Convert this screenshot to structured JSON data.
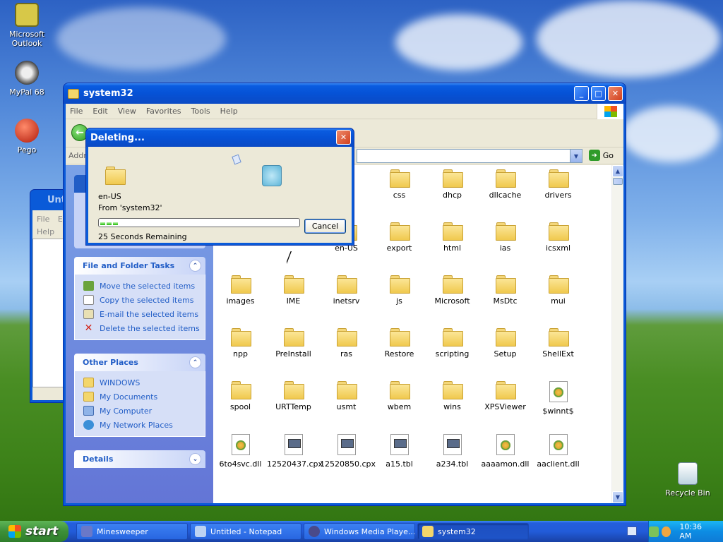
{
  "desktop": {
    "icons": [
      {
        "label": "Microsoft Outlook"
      },
      {
        "label": "MyPal 68"
      },
      {
        "label": "Pego"
      },
      {
        "label": "Recycle Bin"
      }
    ]
  },
  "explorer": {
    "title": "system32",
    "menu": [
      "File",
      "Edit",
      "View",
      "Favorites",
      "Tools",
      "Help"
    ],
    "address_label": "Address",
    "go_label": "Go",
    "file_tasks": {
      "title": "File and Folder Tasks",
      "items": [
        "Move the selected items",
        "Copy the selected items",
        "E-mail the selected items",
        "Delete the selected items"
      ]
    },
    "other_places": {
      "title": "Other Places",
      "items": [
        "WINDOWS",
        "My Documents",
        "My Computer",
        "My Network Places"
      ]
    },
    "details": {
      "title": "Details"
    },
    "files": [
      {
        "name": "css",
        "type": "folder"
      },
      {
        "name": "dhcp",
        "type": "folder"
      },
      {
        "name": "dllcache",
        "type": "folder"
      },
      {
        "name": "drivers",
        "type": "folder"
      },
      {
        "name": "en-US",
        "type": "folder"
      },
      {
        "name": "export",
        "type": "folder"
      },
      {
        "name": "html",
        "type": "folder"
      },
      {
        "name": "ias",
        "type": "folder"
      },
      {
        "name": "icsxml",
        "type": "folder"
      },
      {
        "name": "images",
        "type": "folder"
      },
      {
        "name": "IME",
        "type": "folder"
      },
      {
        "name": "inetsrv",
        "type": "folder"
      },
      {
        "name": "js",
        "type": "folder"
      },
      {
        "name": "Microsoft",
        "type": "folder"
      },
      {
        "name": "MsDtc",
        "type": "folder"
      },
      {
        "name": "mui",
        "type": "folder"
      },
      {
        "name": "npp",
        "type": "folder"
      },
      {
        "name": "PreInstall",
        "type": "folder"
      },
      {
        "name": "ras",
        "type": "folder"
      },
      {
        "name": "Restore",
        "type": "folder"
      },
      {
        "name": "scripting",
        "type": "folder"
      },
      {
        "name": "Setup",
        "type": "folder"
      },
      {
        "name": "ShellExt",
        "type": "folder"
      },
      {
        "name": "spool",
        "type": "folder"
      },
      {
        "name": "URTTemp",
        "type": "folder"
      },
      {
        "name": "usmt",
        "type": "folder"
      },
      {
        "name": "wbem",
        "type": "folder"
      },
      {
        "name": "wins",
        "type": "folder"
      },
      {
        "name": "XPSViewer",
        "type": "folder"
      },
      {
        "name": "$winnt$",
        "type": "dll"
      },
      {
        "name": "6to4svc.dll",
        "type": "dll"
      },
      {
        "name": "12520437.cpx",
        "type": "tbl"
      },
      {
        "name": "12520850.cpx",
        "type": "tbl"
      },
      {
        "name": "a15.tbl",
        "type": "tbl"
      },
      {
        "name": "a234.tbl",
        "type": "tbl"
      },
      {
        "name": "aaaamon.dll",
        "type": "dll"
      },
      {
        "name": "aaclient.dll",
        "type": "dll"
      }
    ]
  },
  "notepad_behind": {
    "title": "Unt",
    "menu": [
      "File",
      "E",
      "Help"
    ]
  },
  "dialog": {
    "title": "Deleting...",
    "item_name": "en-US",
    "from_text": "From 'system32'",
    "progress_fraction": 0.09,
    "remaining": "25 Seconds Remaining",
    "cancel_label": "Cancel"
  },
  "taskbar": {
    "start_label": "start",
    "tasks": [
      {
        "label": "Minesweeper",
        "icon": "minesweeper-icon"
      },
      {
        "label": "Untitled - Notepad",
        "icon": "notepad-icon"
      },
      {
        "label": "Windows Media Playe...",
        "icon": "media-player-icon"
      },
      {
        "label": "system32",
        "icon": "folder-icon",
        "active": true
      }
    ],
    "clock": "10:36 AM"
  }
}
